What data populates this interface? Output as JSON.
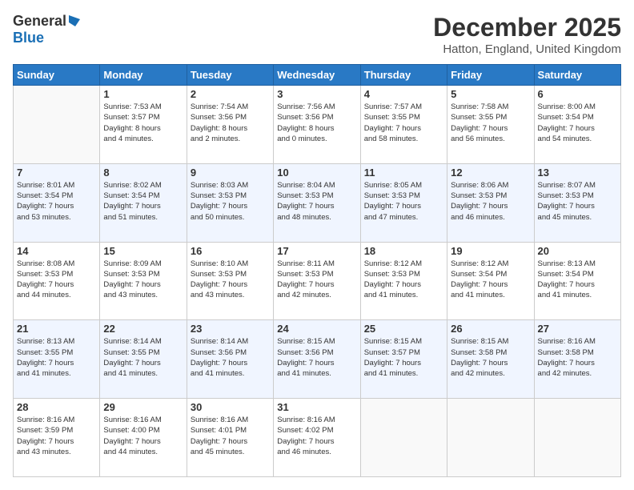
{
  "logo": {
    "line1": "General",
    "line2": "Blue"
  },
  "title": "December 2025",
  "location": "Hatton, England, United Kingdom",
  "days_of_week": [
    "Sunday",
    "Monday",
    "Tuesday",
    "Wednesday",
    "Thursday",
    "Friday",
    "Saturday"
  ],
  "weeks": [
    [
      {
        "day": "",
        "info": ""
      },
      {
        "day": "1",
        "info": "Sunrise: 7:53 AM\nSunset: 3:57 PM\nDaylight: 8 hours\nand 4 minutes."
      },
      {
        "day": "2",
        "info": "Sunrise: 7:54 AM\nSunset: 3:56 PM\nDaylight: 8 hours\nand 2 minutes."
      },
      {
        "day": "3",
        "info": "Sunrise: 7:56 AM\nSunset: 3:56 PM\nDaylight: 8 hours\nand 0 minutes."
      },
      {
        "day": "4",
        "info": "Sunrise: 7:57 AM\nSunset: 3:55 PM\nDaylight: 7 hours\nand 58 minutes."
      },
      {
        "day": "5",
        "info": "Sunrise: 7:58 AM\nSunset: 3:55 PM\nDaylight: 7 hours\nand 56 minutes."
      },
      {
        "day": "6",
        "info": "Sunrise: 8:00 AM\nSunset: 3:54 PM\nDaylight: 7 hours\nand 54 minutes."
      }
    ],
    [
      {
        "day": "7",
        "info": "Sunrise: 8:01 AM\nSunset: 3:54 PM\nDaylight: 7 hours\nand 53 minutes."
      },
      {
        "day": "8",
        "info": "Sunrise: 8:02 AM\nSunset: 3:54 PM\nDaylight: 7 hours\nand 51 minutes."
      },
      {
        "day": "9",
        "info": "Sunrise: 8:03 AM\nSunset: 3:53 PM\nDaylight: 7 hours\nand 50 minutes."
      },
      {
        "day": "10",
        "info": "Sunrise: 8:04 AM\nSunset: 3:53 PM\nDaylight: 7 hours\nand 48 minutes."
      },
      {
        "day": "11",
        "info": "Sunrise: 8:05 AM\nSunset: 3:53 PM\nDaylight: 7 hours\nand 47 minutes."
      },
      {
        "day": "12",
        "info": "Sunrise: 8:06 AM\nSunset: 3:53 PM\nDaylight: 7 hours\nand 46 minutes."
      },
      {
        "day": "13",
        "info": "Sunrise: 8:07 AM\nSunset: 3:53 PM\nDaylight: 7 hours\nand 45 minutes."
      }
    ],
    [
      {
        "day": "14",
        "info": "Sunrise: 8:08 AM\nSunset: 3:53 PM\nDaylight: 7 hours\nand 44 minutes."
      },
      {
        "day": "15",
        "info": "Sunrise: 8:09 AM\nSunset: 3:53 PM\nDaylight: 7 hours\nand 43 minutes."
      },
      {
        "day": "16",
        "info": "Sunrise: 8:10 AM\nSunset: 3:53 PM\nDaylight: 7 hours\nand 43 minutes."
      },
      {
        "day": "17",
        "info": "Sunrise: 8:11 AM\nSunset: 3:53 PM\nDaylight: 7 hours\nand 42 minutes."
      },
      {
        "day": "18",
        "info": "Sunrise: 8:12 AM\nSunset: 3:53 PM\nDaylight: 7 hours\nand 41 minutes."
      },
      {
        "day": "19",
        "info": "Sunrise: 8:12 AM\nSunset: 3:54 PM\nDaylight: 7 hours\nand 41 minutes."
      },
      {
        "day": "20",
        "info": "Sunrise: 8:13 AM\nSunset: 3:54 PM\nDaylight: 7 hours\nand 41 minutes."
      }
    ],
    [
      {
        "day": "21",
        "info": "Sunrise: 8:13 AM\nSunset: 3:55 PM\nDaylight: 7 hours\nand 41 minutes."
      },
      {
        "day": "22",
        "info": "Sunrise: 8:14 AM\nSunset: 3:55 PM\nDaylight: 7 hours\nand 41 minutes."
      },
      {
        "day": "23",
        "info": "Sunrise: 8:14 AM\nSunset: 3:56 PM\nDaylight: 7 hours\nand 41 minutes."
      },
      {
        "day": "24",
        "info": "Sunrise: 8:15 AM\nSunset: 3:56 PM\nDaylight: 7 hours\nand 41 minutes."
      },
      {
        "day": "25",
        "info": "Sunrise: 8:15 AM\nSunset: 3:57 PM\nDaylight: 7 hours\nand 41 minutes."
      },
      {
        "day": "26",
        "info": "Sunrise: 8:15 AM\nSunset: 3:58 PM\nDaylight: 7 hours\nand 42 minutes."
      },
      {
        "day": "27",
        "info": "Sunrise: 8:16 AM\nSunset: 3:58 PM\nDaylight: 7 hours\nand 42 minutes."
      }
    ],
    [
      {
        "day": "28",
        "info": "Sunrise: 8:16 AM\nSunset: 3:59 PM\nDaylight: 7 hours\nand 43 minutes."
      },
      {
        "day": "29",
        "info": "Sunrise: 8:16 AM\nSunset: 4:00 PM\nDaylight: 7 hours\nand 44 minutes."
      },
      {
        "day": "30",
        "info": "Sunrise: 8:16 AM\nSunset: 4:01 PM\nDaylight: 7 hours\nand 45 minutes."
      },
      {
        "day": "31",
        "info": "Sunrise: 8:16 AM\nSunset: 4:02 PM\nDaylight: 7 hours\nand 46 minutes."
      },
      {
        "day": "",
        "info": ""
      },
      {
        "day": "",
        "info": ""
      },
      {
        "day": "",
        "info": ""
      }
    ]
  ]
}
